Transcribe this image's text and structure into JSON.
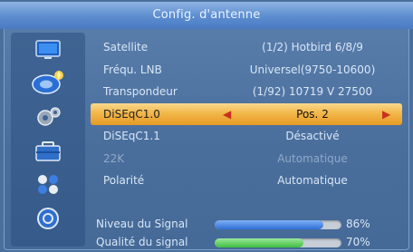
{
  "title": "Config. d'antenne",
  "sidebar": {
    "icons": [
      "tv-icon",
      "satellite-dish-icon",
      "settings-gears-icon",
      "toolbox-icon",
      "network-icon",
      "power-icon"
    ]
  },
  "menu": [
    {
      "label": "Satellite",
      "value": "(1/2) Hotbird 6/8/9"
    },
    {
      "label": "Fréqu. LNB",
      "value": "Universel(9750-10600)"
    },
    {
      "label": "Transpondeur",
      "value": "(1/92) 10719 V 27500"
    },
    {
      "label": "DiSEqC1.0",
      "value": "Pos. 2"
    },
    {
      "label": "DiSEqC1.1",
      "value": "Désactivé"
    },
    {
      "label": "22K",
      "value": "Automatique"
    },
    {
      "label": "Polarité",
      "value": "Automatique"
    }
  ],
  "signal": {
    "level": {
      "label": "Niveau du Signal",
      "percent_text": "86%",
      "value": 0.86,
      "color": "#2f6fd6"
    },
    "quality": {
      "label": "Qualité du signal",
      "percent_text": "70%",
      "value": 0.7,
      "color": "#3fbf3f"
    }
  },
  "colors": {
    "selected_gradient_top": "#f9d98d",
    "selected_gradient_bottom": "#e79a26",
    "arrow": "#c8321d",
    "title_bar": "#5f8fd0"
  }
}
